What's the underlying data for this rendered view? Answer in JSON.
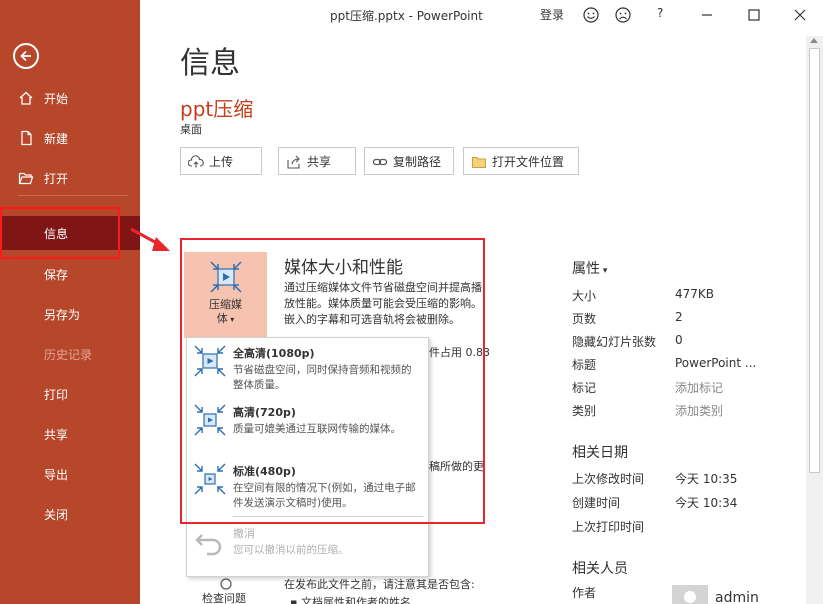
{
  "window": {
    "title": "ppt压缩.pptx  -  PowerPoint",
    "login": "登录",
    "help": "?"
  },
  "sidebar": {
    "items": [
      {
        "label": "开始"
      },
      {
        "label": "新建"
      },
      {
        "label": "打开"
      },
      {
        "label": "信息"
      },
      {
        "label": "保存"
      },
      {
        "label": "另存为"
      },
      {
        "label": "历史记录"
      },
      {
        "label": "打印"
      },
      {
        "label": "共享"
      },
      {
        "label": "导出"
      },
      {
        "label": "关闭"
      }
    ]
  },
  "main": {
    "page_title": "信息",
    "doc_name": "ppt压缩",
    "doc_location": "桌面",
    "actions": {
      "upload": "上传",
      "share": "共享",
      "copy_path": "复制路径",
      "open_location": "打开文件位置"
    }
  },
  "media": {
    "tile_label_1": "压缩媒",
    "tile_label_2": "体",
    "title": "媒体大小和性能",
    "description": "通过压缩媒体文件节省磁盘空间并提高播放性能。媒体质量可能会受压缩的影响。嵌入的字幕和可选音轨将会被删除。",
    "peek_occupy": "件占用 0.83",
    "peek_made": "稿所做的更"
  },
  "dropdown": {
    "items": [
      {
        "title": "全高清(1080p)",
        "desc": "节省磁盘空间，同时保持音频和视频的整体质量。"
      },
      {
        "title": "高清(720p)",
        "desc": "质量可媲美通过互联网传输的媒体。"
      },
      {
        "title": "标准(480p)",
        "desc": "在空间有限的情况下(例如，通过电子邮件发送演示文稿时)使用。"
      },
      {
        "title": "撤消",
        "desc": "您可以撤消以前的压缩。"
      }
    ]
  },
  "inspect": {
    "label": "检查问题",
    "desc": "在发布此文件之前，请注意其是否包含:",
    "sub": "文档属性和作者的姓名"
  },
  "properties": {
    "heading": "属性",
    "rows": [
      {
        "key": "大小",
        "value": "477KB"
      },
      {
        "key": "页数",
        "value": "2"
      },
      {
        "key": "隐藏幻灯片张数",
        "value": "0"
      },
      {
        "key": "标题",
        "value": "PowerPoint ..."
      },
      {
        "key": "标记",
        "value": "添加标记"
      },
      {
        "key": "类别",
        "value": "添加类别"
      }
    ],
    "dates_heading": "相关日期",
    "dates": [
      {
        "key": "上次修改时间",
        "value": "今天 10:35"
      },
      {
        "key": "创建时间",
        "value": "今天 10:34"
      },
      {
        "key": "上次打印时间",
        "value": ""
      }
    ],
    "people_heading": "相关人员",
    "author_key": "作者",
    "author_name": "admin"
  }
}
